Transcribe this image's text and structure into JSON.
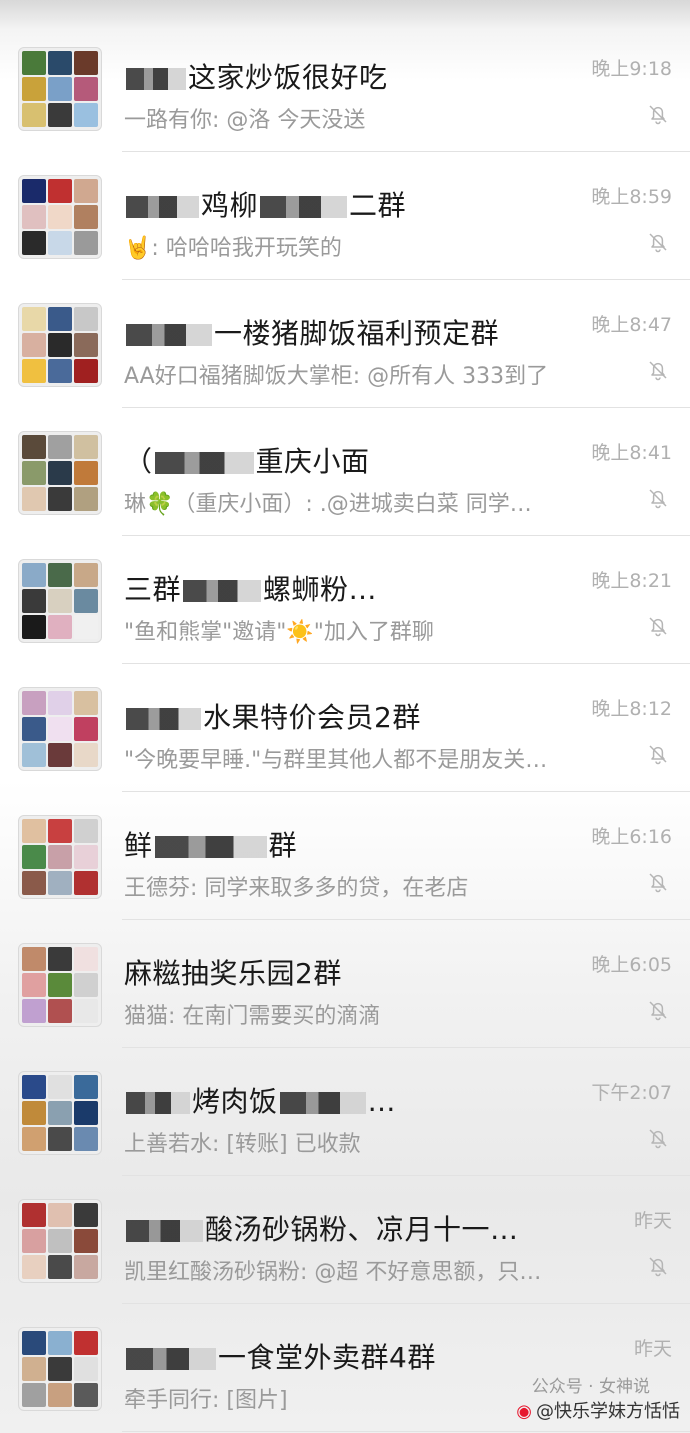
{
  "chats": [
    {
      "title": "这家炒饭很好吃",
      "masked_prefix": true,
      "preview": "一路有你: @洛 今天没送",
      "time": "晚上9:18",
      "muted": true,
      "avatar_colors": [
        "#4a7a3a",
        "#2a4a6a",
        "#6a3a2a",
        "#c9a23a",
        "#7aa0c8",
        "#b55a7a",
        "#d8c070",
        "#3a3a3a",
        "#9ac0e0"
      ]
    },
    {
      "title": "鸡柳",
      "masked_prefix": true,
      "title_suffix": "二群",
      "preview": "哈哈哈我开玩笑的",
      "preview_emoji": "🤘",
      "time": "晚上8:59",
      "muted": true,
      "avatar_colors": [
        "#1a2a6a",
        "#c03030",
        "#d0a890",
        "#e0c0c0",
        "#f0d8c8",
        "#b08060",
        "#2a2a2a",
        "#c8d8e8",
        "#9a9a9a"
      ]
    },
    {
      "title": "一楼猪脚饭福利预定群",
      "masked_prefix": true,
      "preview": "AA好口福猪脚饭大掌柜: @所有人 333到了",
      "time": "晚上8:47",
      "muted": true,
      "avatar_colors": [
        "#e8d8a8",
        "#3a5a8a",
        "#c8c8c8",
        "#d8b0a0",
        "#2a2a2a",
        "#8a6a5a",
        "#f0c040",
        "#4a6a9a",
        "#a02020"
      ]
    },
    {
      "title": "重庆小面",
      "masked_prefix": true,
      "title_open": "（",
      "preview": "琳🍀（重庆小面）: .@进城卖白菜 同学…",
      "time": "晚上8:41",
      "muted": true,
      "avatar_colors": [
        "#5a4a3a",
        "#a0a0a0",
        "#d0c0a0",
        "#8a9a6a",
        "#2a3a4a",
        "#c07a3a",
        "#e0c8b0",
        "#3a3a3a",
        "#b0a080"
      ]
    },
    {
      "title": "三群",
      "masked_prefix": false,
      "title_suffix": "螺蛳粉…",
      "preview": "\"鱼和熊掌\"邀请\"☀️\"加入了群聊",
      "time": "晚上8:21",
      "muted": true,
      "avatar_colors": [
        "#8aaac8",
        "#4a6a4a",
        "#c8a888",
        "#3a3a3a",
        "#d8d0c0",
        "#6a8aa0",
        "#1a1a1a",
        "#e0b0c0",
        "#f0f0f0"
      ]
    },
    {
      "title": "水果特价会员2群",
      "masked_prefix": true,
      "preview": "\"今晚要早睡.\"与群里其他人都不是朋友关…",
      "time": "晚上8:12",
      "muted": true,
      "avatar_colors": [
        "#c8a0c0",
        "#e0d0e8",
        "#d8c0a0",
        "#3a5a8a",
        "#f0e0f0",
        "#c04060",
        "#a0c0d8",
        "#6a3a3a",
        "#e8d8c8"
      ]
    },
    {
      "title": "鲜",
      "masked_prefix": false,
      "title_suffix": "群",
      "preview": "王德芬: 同学来取多多的贷，在老店",
      "time": "晚上6:16",
      "muted": true,
      "avatar_colors": [
        "#e0c0a0",
        "#c84040",
        "#d0d0d0",
        "#4a8a4a",
        "#c8a0a8",
        "#e8d0d8",
        "#8a5a4a",
        "#a0b0c0",
        "#b03030"
      ]
    },
    {
      "title": "麻糍抽奖乐园2群",
      "masked_prefix": false,
      "preview": "猫猫: 在南门需要买的滴滴",
      "time": "晚上6:05",
      "muted": true,
      "avatar_colors": [
        "#c08a6a",
        "#3a3a3a",
        "#f0e0e0",
        "#e0a0a0",
        "#5a8a3a",
        "#d0d0d0",
        "#c0a0d0",
        "#b05050",
        "#e8e8e8"
      ]
    },
    {
      "title": "烤肉饭",
      "masked_prefix": true,
      "title_suffix": "…",
      "preview": "上善若水: [转账] 已收款",
      "time": "下午2:07",
      "muted": true,
      "avatar_colors": [
        "#2a4a8a",
        "#e0e0e0",
        "#3a6a9a",
        "#c08a3a",
        "#8aa0b0",
        "#1a3a6a",
        "#d0a070",
        "#4a4a4a",
        "#6a8ab0"
      ]
    },
    {
      "title": "酸汤砂锅粉、凉月十一…",
      "masked_prefix": true,
      "preview": "凯里红酸汤砂锅粉: @超 不好意思额，只…",
      "time": "昨天",
      "muted": true,
      "avatar_colors": [
        "#b03030",
        "#e0c0b0",
        "#3a3a3a",
        "#d8a0a0",
        "#c0c0c0",
        "#8a4a3a",
        "#e8d0c0",
        "#4a4a4a",
        "#c8a8a0"
      ]
    },
    {
      "title": "一食堂外卖群4群",
      "masked_prefix": true,
      "preview": "牵手同行: [图片]",
      "time": "昨天",
      "muted": false,
      "avatar_colors": [
        "#2a4a7a",
        "#8ab0d0",
        "#c03030",
        "#d0b090",
        "#3a3a3a",
        "#e0e0e0",
        "#a0a0a0",
        "#c8a080",
        "#5a5a5a"
      ]
    }
  ],
  "watermark": {
    "gzh": "公众号 · 女神说",
    "weibo": "@快乐学妹方恬恬"
  }
}
